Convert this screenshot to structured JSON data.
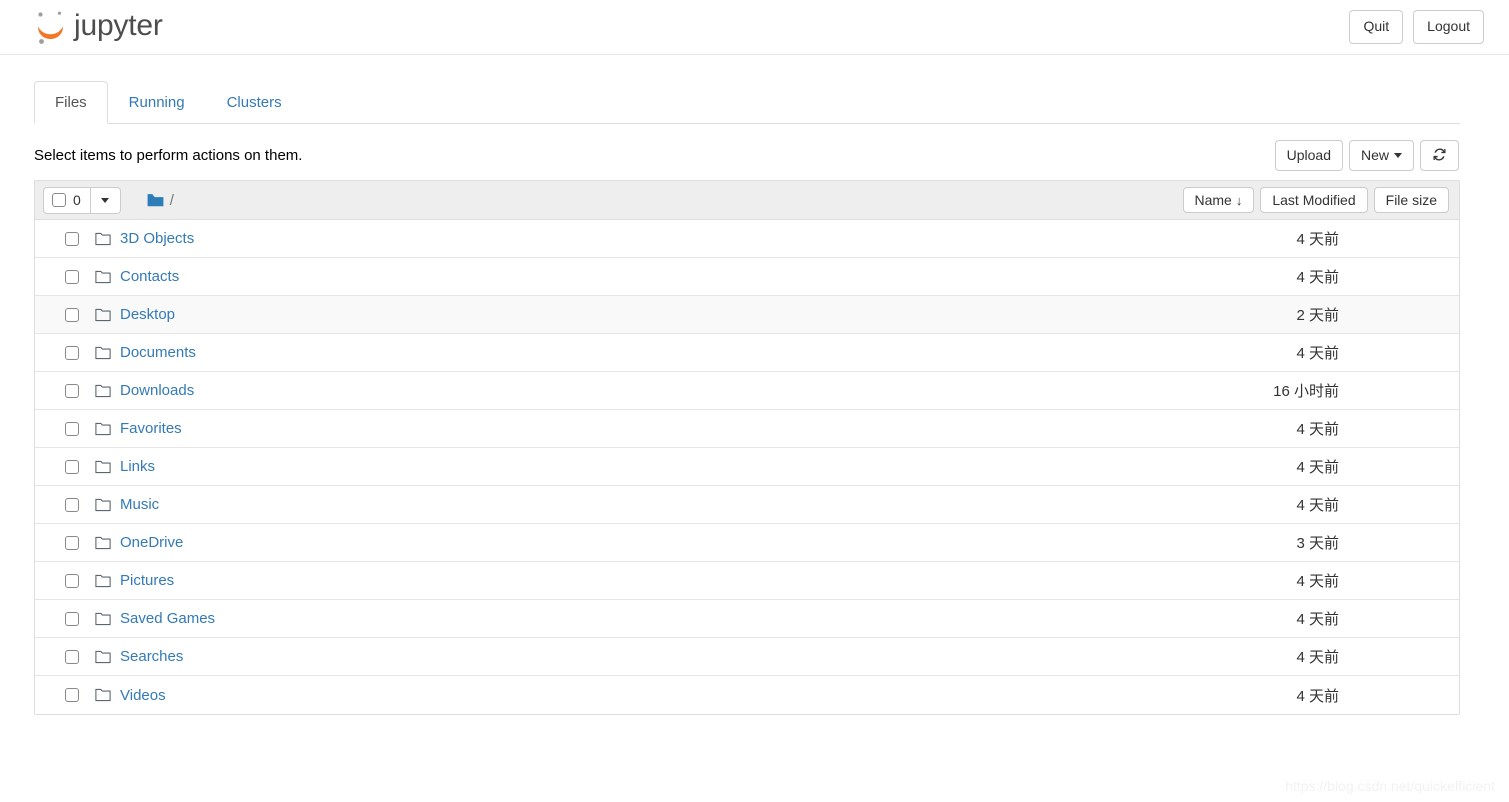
{
  "header": {
    "brand_text": "jupyter",
    "brand_logo_icon": "jupyter-logo-icon",
    "quit_label": "Quit",
    "logout_label": "Logout"
  },
  "tabs": [
    {
      "label": "Files",
      "active": true
    },
    {
      "label": "Running",
      "active": false
    },
    {
      "label": "Clusters",
      "active": false
    }
  ],
  "toolbar": {
    "alert_text": "Select items to perform actions on them.",
    "upload_label": "Upload",
    "new_label": "New",
    "new_caret_icon": "chevron-down-icon",
    "refresh_icon": "refresh-icon"
  },
  "list_header": {
    "select_all_checked": false,
    "selected_count": "0",
    "select_caret_icon": "chevron-down-icon",
    "breadcrumb_folder_icon": "folder-icon",
    "breadcrumb_path": "/",
    "sort_name_label": "Name",
    "sort_name_arrow": "↓",
    "sort_modified_label": "Last Modified",
    "sort_size_label": "File size"
  },
  "files": [
    {
      "name": "3D Objects",
      "icon": "folder-icon",
      "modified": "4 天前",
      "size": "",
      "alt": false
    },
    {
      "name": "Contacts",
      "icon": "folder-icon",
      "modified": "4 天前",
      "size": "",
      "alt": false
    },
    {
      "name": "Desktop",
      "icon": "folder-icon",
      "modified": "2 天前",
      "size": "",
      "alt": true
    },
    {
      "name": "Documents",
      "icon": "folder-icon",
      "modified": "4 天前",
      "size": "",
      "alt": false
    },
    {
      "name": "Downloads",
      "icon": "folder-icon",
      "modified": "16 小时前",
      "size": "",
      "alt": false
    },
    {
      "name": "Favorites",
      "icon": "folder-icon",
      "modified": "4 天前",
      "size": "",
      "alt": false
    },
    {
      "name": "Links",
      "icon": "folder-icon",
      "modified": "4 天前",
      "size": "",
      "alt": false
    },
    {
      "name": "Music",
      "icon": "folder-icon",
      "modified": "4 天前",
      "size": "",
      "alt": false
    },
    {
      "name": "OneDrive",
      "icon": "folder-icon",
      "modified": "3 天前",
      "size": "",
      "alt": false
    },
    {
      "name": "Pictures",
      "icon": "folder-icon",
      "modified": "4 天前",
      "size": "",
      "alt": false
    },
    {
      "name": "Saved Games",
      "icon": "folder-icon",
      "modified": "4 天前",
      "size": "",
      "alt": false
    },
    {
      "name": "Searches",
      "icon": "folder-icon",
      "modified": "4 天前",
      "size": "",
      "alt": false
    },
    {
      "name": "Videos",
      "icon": "folder-icon",
      "modified": "4 天前",
      "size": "",
      "alt": false
    }
  ],
  "watermark": {
    "text": "https://blog.csdn.net/quickefficient"
  },
  "colors": {
    "link": "#337ab7",
    "brand_orange": "#f37726",
    "brand_gray": "#4d4d4d",
    "header_bar": "#eeeeee",
    "folder_blue": "#2c7cb8",
    "folder_outline": "#5c6670",
    "border": "#dddddd",
    "alt_row": "#f9f9f9"
  }
}
